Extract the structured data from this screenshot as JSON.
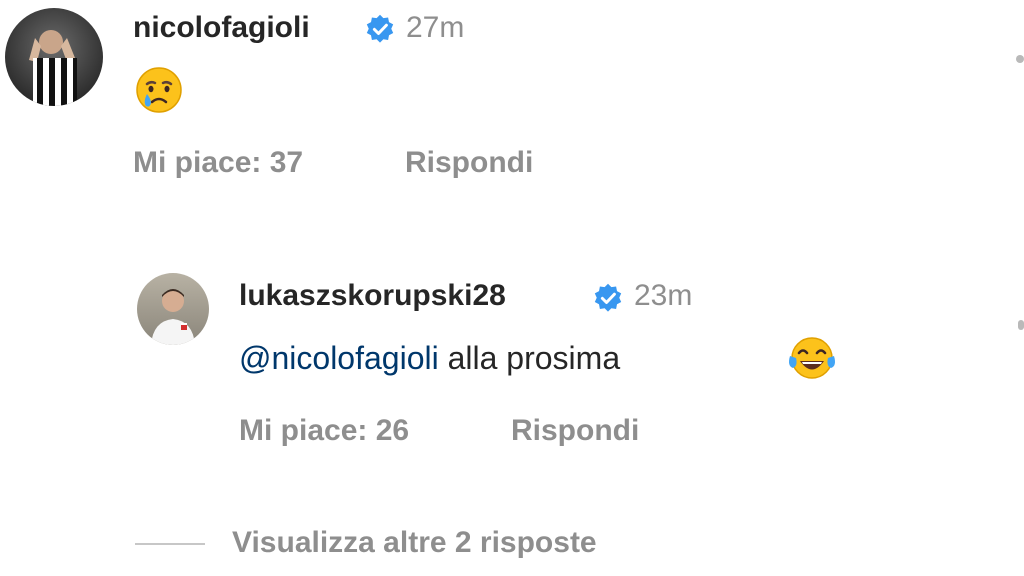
{
  "comments": [
    {
      "username": "nicolofagioli",
      "verified": true,
      "time": "27m",
      "emoji": "crying-face",
      "likes_label": "Mi piace: 37",
      "reply_label": "Rispondi"
    }
  ],
  "reply": {
    "username": "lukaszskorupski28",
    "verified": true,
    "time": "23m",
    "mention": "@nicolofagioli",
    "text": " alla prosima",
    "emoji": "face-with-tears-of-joy",
    "likes_label": "Mi piace: 26",
    "reply_label": "Rispondi"
  },
  "view_more_label": "Visualizza altre 2 risposte",
  "colors": {
    "username": "#262626",
    "muted": "#8e8e8e",
    "mention": "#00376b",
    "verified": "#3897f0"
  }
}
